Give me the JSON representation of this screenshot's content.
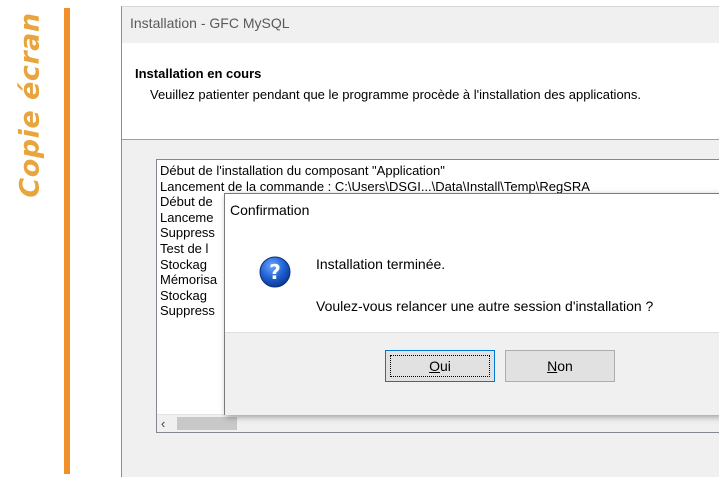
{
  "side_label": "Copie écran",
  "window": {
    "title": "Installation - GFC MySQL",
    "header_title": "Installation en cours",
    "header_description": "Veuillez patienter pendant que le programme procède à l'installation des applications."
  },
  "log": {
    "lines": [
      "Début de l'installation du composant \"Application\"",
      "Lancement de la commande : C:\\Users\\DSGI...\\Data\\Install\\Temp\\RegSRA",
      "Début de",
      "Lanceme",
      "Suppress",
      "Test de l",
      "Stockag",
      "Mémorisa",
      "Stockag",
      "Suppress"
    ],
    "scroll_left_glyph": "‹"
  },
  "dialog": {
    "title": "Confirmation",
    "icon": "question-icon",
    "message_line1": "Installation terminée.",
    "message_line2": "Voulez-vous relancer une autre session d'installation ?",
    "buttons": {
      "yes_label": "Oui",
      "no_label": "Non"
    }
  },
  "colors": {
    "accent_orange": "#f0902a",
    "side_text": "#e8a43d",
    "button_default_border": "#0078d7"
  }
}
